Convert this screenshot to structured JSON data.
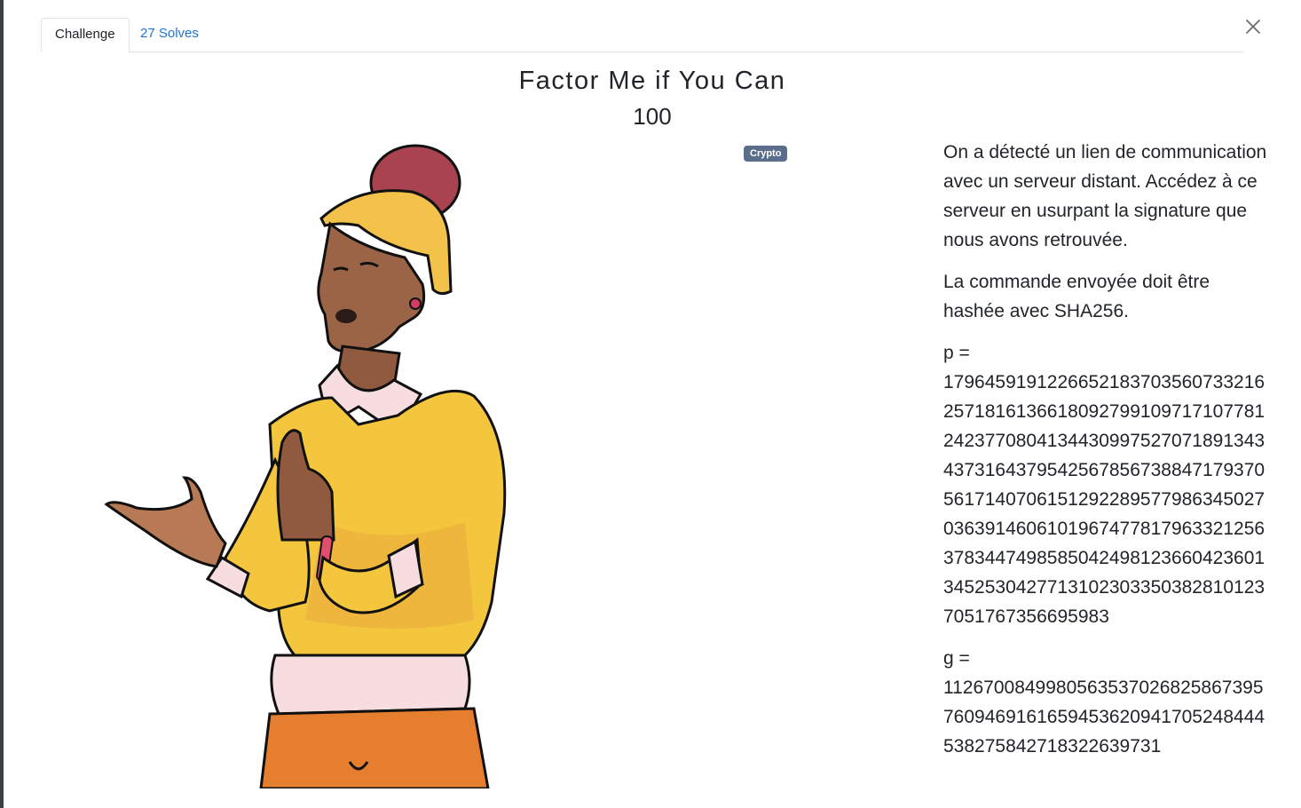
{
  "tabs": {
    "challenge_label": "Challenge",
    "solves_label": "27 Solves"
  },
  "challenge": {
    "name": "Factor Me if You Can",
    "value": "100",
    "category_badge": "Crypto"
  },
  "description": {
    "paragraph1": "On a détecté un lien de communication avec un serveur distant. Accédez à ce serveur en usurpant la signature que nous avons retrouvée.",
    "paragraph2": "La commande envoyée doit être hashée avec SHA256.",
    "p_label": "p =",
    "p_value": "179645919122665218370356073321625718161366180927991097171077812423770804134430997527071891343437316437954256785673884717937056171407061512922895779863450270363914606101967477817963321256378344749858504249812366042360134525304277131023033503828101237051767356695983",
    "g_label": "g =",
    "g_value_visible": "11267008499805635370268258673957609469161659453620941705248444538275842718322639731"
  },
  "colors": {
    "link": "#1f74d6",
    "badge_bg": "#5a6d8a",
    "text": "#212529",
    "border": "#dee2e6"
  },
  "icons": {
    "close": "close-icon"
  }
}
